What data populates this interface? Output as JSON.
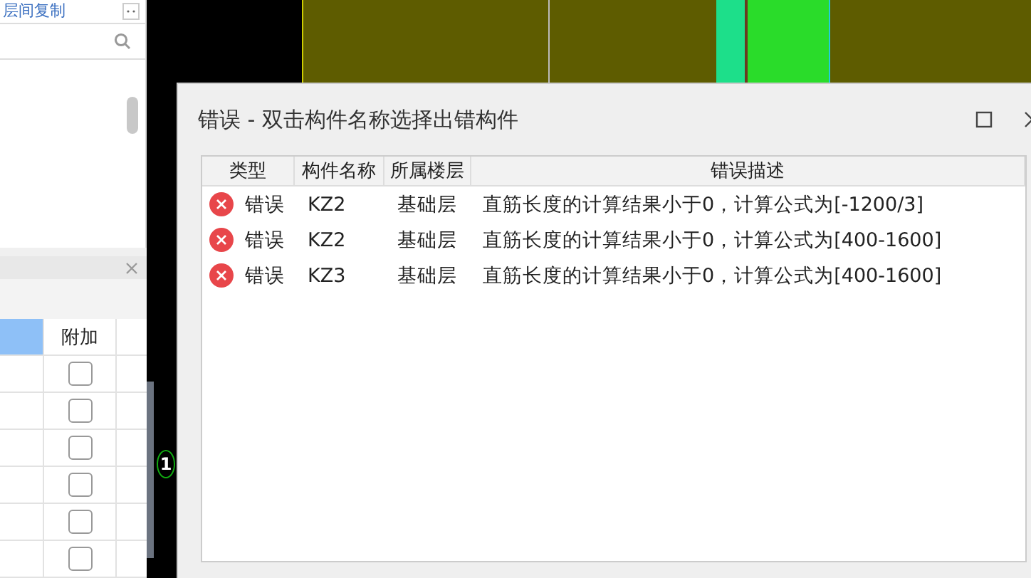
{
  "left_panel": {
    "header": "层间复制",
    "columns": [
      "附加"
    ],
    "rows": [
      {
        "checked": false
      },
      {
        "checked": false
      },
      {
        "checked": false
      },
      {
        "checked": false
      },
      {
        "checked": false
      },
      {
        "checked": false
      }
    ]
  },
  "canvas": {
    "axis_label": "1"
  },
  "dialog": {
    "title": "错误 - 双击构件名称选择出错构件",
    "columns": [
      "类型",
      "构件名称",
      "所属楼层",
      "错误描述"
    ],
    "rows": [
      {
        "type": "错误",
        "name": "KZ2",
        "floor": "基础层",
        "description": "直筋长度的计算结果小于0，计算公式为[-1200/3]"
      },
      {
        "type": "错误",
        "name": "KZ2",
        "floor": "基础层",
        "description": "直筋长度的计算结果小于0，计算公式为[400-1600]"
      },
      {
        "type": "错误",
        "name": "KZ3",
        "floor": "基础层",
        "description": "直筋长度的计算结果小于0，计算公式为[400-1600]"
      }
    ]
  }
}
